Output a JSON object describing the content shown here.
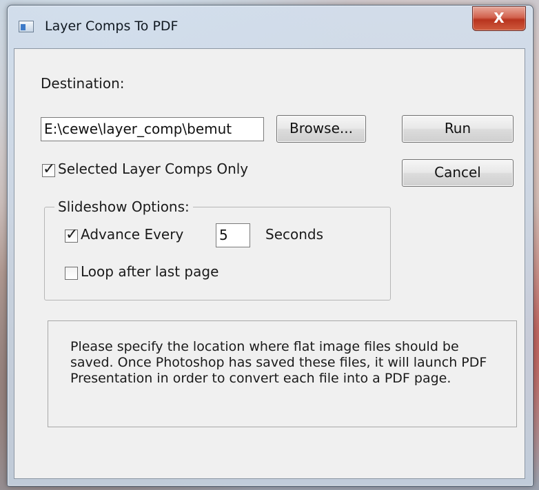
{
  "window": {
    "title": "Layer Comps To PDF",
    "close_label": "X"
  },
  "destination": {
    "label": "Destination:",
    "path_value": "E:\\cewe\\layer_comp\\bemut",
    "browse_label": "Browse..."
  },
  "actions": {
    "run_label": "Run",
    "cancel_label": "Cancel"
  },
  "selected_only": {
    "label": "Selected Layer Comps Only",
    "checked": true
  },
  "slideshow": {
    "group_label": "Slideshow Options:",
    "advance_label": "Advance Every",
    "advance_checked": true,
    "seconds_value": "5",
    "seconds_label": "Seconds",
    "loop_label": "Loop after last page",
    "loop_checked": false
  },
  "info": {
    "text": "Please specify the location where flat image files should be saved. Once Photoshop has saved these files, it will launch PDF Presentation in order to convert each file into a PDF page."
  },
  "icons": {
    "app": "app-window-icon",
    "close": "close-icon",
    "check": "checkmark-icon"
  },
  "colors": {
    "close_button": "#c94a34",
    "client_bg": "#f0f0f0"
  }
}
